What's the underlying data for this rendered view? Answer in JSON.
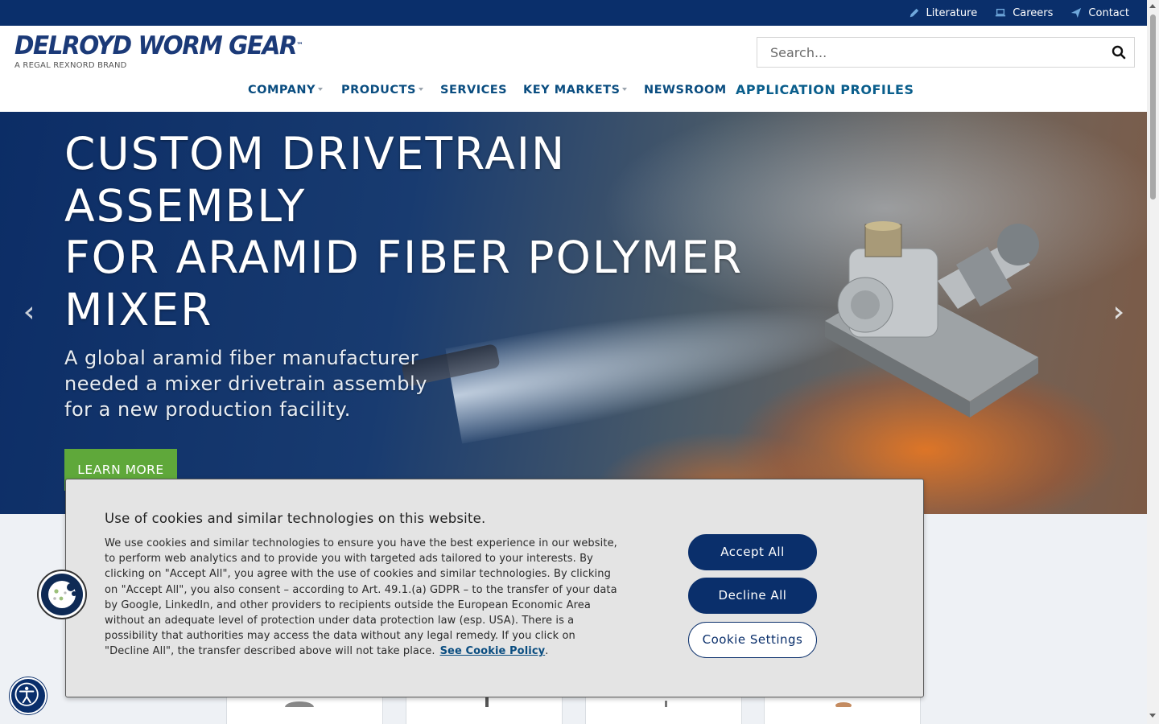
{
  "topbar": {
    "links": [
      {
        "label": "Literature",
        "icon": "pencil-icon"
      },
      {
        "label": "Careers",
        "icon": "laptop-icon"
      },
      {
        "label": "Contact",
        "icon": "paper-plane-icon"
      }
    ]
  },
  "logo": {
    "name": "DELROYD WORM GEAR",
    "tagline": "A REGAL REXNORD BRAND"
  },
  "search": {
    "placeholder": "Search...",
    "value": ""
  },
  "nav": {
    "items": [
      {
        "label": "COMPANY",
        "dropdown": true
      },
      {
        "label": "PRODUCTS",
        "dropdown": true
      },
      {
        "label": "SERVICES",
        "dropdown": false
      },
      {
        "label": "KEY MARKETS",
        "dropdown": true
      },
      {
        "label": "NEWSROOM",
        "dropdown": false
      },
      {
        "label": "APPLICATION PROFILES",
        "dropdown": false
      }
    ]
  },
  "hero": {
    "title_lines": [
      "CUSTOM DRIVETRAIN",
      "ASSEMBLY",
      "FOR ARAMID FIBER POLYMER",
      "MIXER"
    ],
    "subtitle": "A global aramid fiber manufacturer needed a mixer drivetrain assembly for a new production facility.",
    "cta": "LEARN MORE"
  },
  "cookie_banner": {
    "title": "Use of cookies and similar technologies on this website.",
    "body": "We use cookies and similar technologies to ensure you have the best experience in our website, to perform web analytics and to provide you with targeted ads tailored to your interests. By clicking on \"Accept All\", you agree with the use of cookies and similar technologies. By clicking on \"Accept All\", you also consent – according to Art. 49.1.(a) GDPR – to the transfer of your data by Google, LinkedIn, and other providers to recipients outside the European Economic Area without an adequate level of protection under data protection law (esp. USA). There is a possibility that authorities may access the data without any legal remedy. If you click on \"Decline All\", the transfer described above will not take place.",
    "policy_link": "See Cookie Policy",
    "buttons": {
      "accept": "Accept All",
      "decline": "Decline All",
      "settings": "Cookie Settings"
    }
  },
  "colors": {
    "brand_navy": "#0a2f6b",
    "nav_blue": "#0a4d80",
    "cta_green": "#5fa83a"
  }
}
